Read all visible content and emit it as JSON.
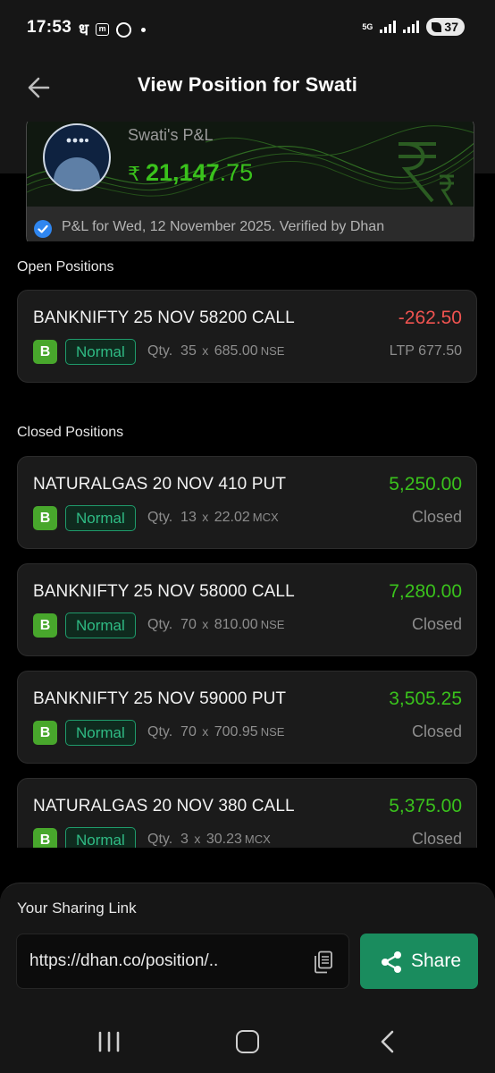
{
  "status_bar": {
    "time": "17:53",
    "dha_glyph": "ध",
    "m_glyph": "m",
    "network": "5G",
    "battery": "37"
  },
  "header": {
    "title": "View Position for Swati",
    "back_icon": "arrow-left-icon"
  },
  "pnl_card": {
    "name": "Swati's P&L",
    "currency": "₹",
    "amount_main": "21,147",
    "amount_decimal": ".75",
    "verified_text": "P&L for Wed, 12 November 2025. Verified by Dhan"
  },
  "open_positions": {
    "title": "Open Positions",
    "items": [
      {
        "name": "BANKNIFTY 25 NOV 58200 CALL",
        "pnl": "-262.50",
        "side": "B",
        "type": "Normal",
        "qty_label": "Qty.",
        "qty": "35",
        "x": "x",
        "price": "685.00",
        "exchange": "NSE",
        "status": "LTP  677.50"
      }
    ]
  },
  "closed_positions": {
    "title": "Closed Positions",
    "items": [
      {
        "name": "NATURALGAS 20 NOV 410 PUT",
        "pnl": "5,250.00",
        "side": "B",
        "type": "Normal",
        "qty_label": "Qty.",
        "qty": "13",
        "x": "x",
        "price": "22.02",
        "exchange": "MCX",
        "status": "Closed"
      },
      {
        "name": "BANKNIFTY 25 NOV 58000 CALL",
        "pnl": "7,280.00",
        "side": "B",
        "type": "Normal",
        "qty_label": "Qty.",
        "qty": "70",
        "x": "x",
        "price": "810.00",
        "exchange": "NSE",
        "status": "Closed"
      },
      {
        "name": "BANKNIFTY 25 NOV 59000 PUT",
        "pnl": "3,505.25",
        "side": "B",
        "type": "Normal",
        "qty_label": "Qty.",
        "qty": "70",
        "x": "x",
        "price": "700.95",
        "exchange": "NSE",
        "status": "Closed"
      },
      {
        "name": "NATURALGAS 20 NOV 380 CALL",
        "pnl": "5,375.00",
        "side": "B",
        "type": "Normal",
        "qty_label": "Qty.",
        "qty": "3",
        "x": "x",
        "price": "30.23",
        "exchange": "MCX",
        "status": "Closed"
      }
    ]
  },
  "sharing": {
    "title": "Your Sharing Link",
    "url": "https://dhan.co/position/..",
    "copy_icon": "copy-icon",
    "share_label": "Share",
    "share_icon": "share-icon"
  },
  "nav": {
    "recent_icon": "recent-apps-icon",
    "home_icon": "home-icon",
    "back_icon": "back-icon"
  },
  "colors": {
    "profit": "#3ac21c",
    "loss": "#ef5350",
    "accent": "#1a8c5e",
    "buy_badge": "#48a72c",
    "background": "#000000"
  }
}
